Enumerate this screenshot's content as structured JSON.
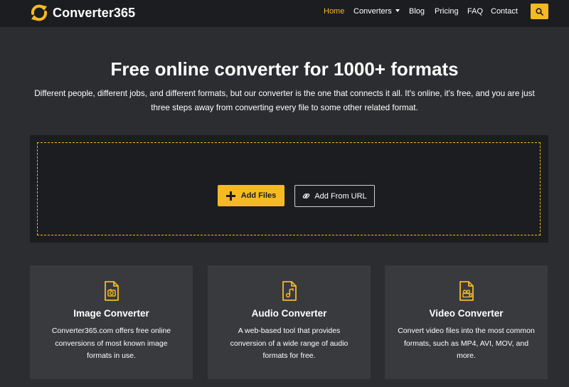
{
  "brand": {
    "name": "Converter365",
    "accent": "#f5b924"
  },
  "nav": {
    "items": [
      {
        "label": "Home",
        "active": true
      },
      {
        "label": "Converters",
        "dropdown": true
      },
      {
        "label": "Blog"
      },
      {
        "label": "Pricing"
      },
      {
        "label": "FAQ"
      },
      {
        "label": "Contact"
      }
    ],
    "search_icon": "search-icon"
  },
  "hero": {
    "title": "Free online converter for 1000+ formats",
    "description": "Different people, different jobs, and different formats, but our converter is the one that connects it all. It's online, it's free, and you are just three steps away from converting every file to some other related format."
  },
  "upload": {
    "add_files_label": "Add Files",
    "add_url_label": "Add From URL"
  },
  "cards": [
    {
      "title": "Image Converter",
      "description": "Converter365.com offers free online conversions of most known image formats in use.",
      "icon": "image-file-icon"
    },
    {
      "title": "Audio Converter",
      "description": "A web-based tool that provides conversion of a wide range of audio formats for free.",
      "icon": "audio-file-icon"
    },
    {
      "title": "Video Converter",
      "description": "Convert video files into the most common formats, such as MP4, AVI, MOV, and more.",
      "icon": "video-file-icon"
    }
  ]
}
